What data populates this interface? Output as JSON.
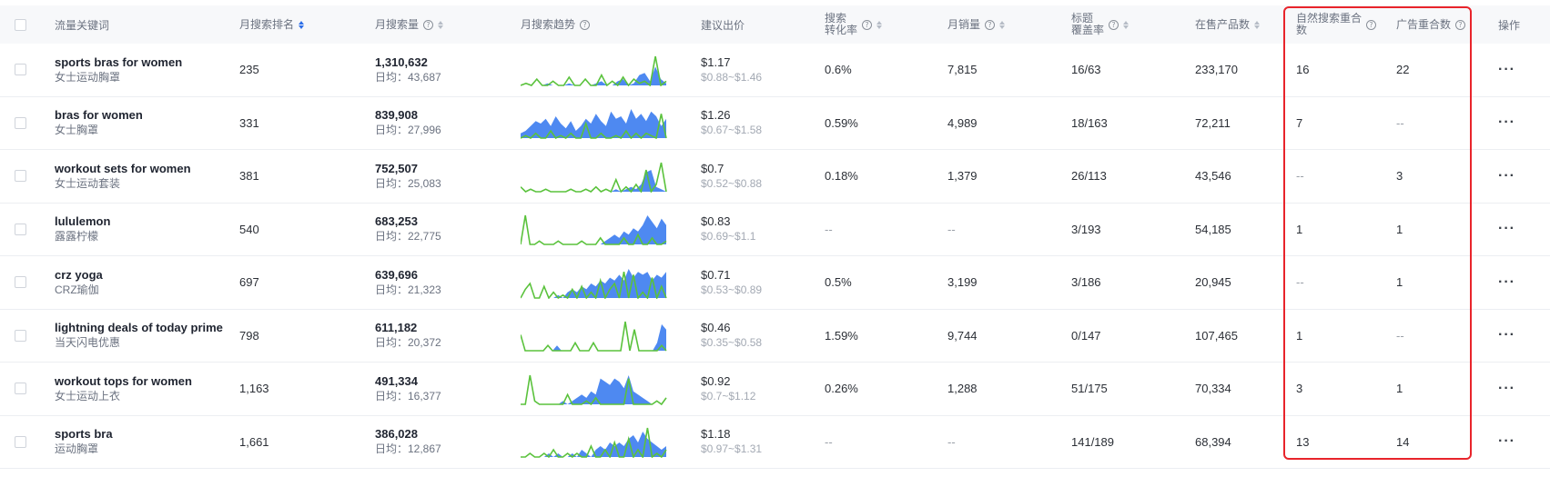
{
  "headers": {
    "keyword": "流量关键词",
    "rank": "月搜索排名",
    "volume": "月搜索量",
    "trend": "月搜索趋势",
    "bid": "建议出价",
    "conv_line1": "搜索",
    "conv_line2": "转化率",
    "sales": "月销量",
    "title_line1": "标题",
    "title_line2": "覆盖率",
    "products": "在售产品数",
    "organic_line1": "自然搜索重合",
    "organic_line2": "数",
    "ads": "广告重合数",
    "actions": "操作"
  },
  "icons": {
    "help": "question-circle-icon",
    "sort": "sort-caret-icon",
    "more": "more-horizontal-icon",
    "checkbox": "checkbox"
  },
  "colors": {
    "highlight_border": "#e8242b",
    "trend_blue": "#3b7cf0",
    "trend_green": "#5ac23c",
    "sort_active": "#2b6de8"
  },
  "rows": [
    {
      "keyword": "sports bras for women",
      "keyword_cn": "女士运动胸罩",
      "rank": "235",
      "volume": "1,310,632",
      "daily": "日均：43,687",
      "bid": "$1.17",
      "bid_range": "$0.88~$1.46",
      "conv": "0.6%",
      "sales": "7,815",
      "title_cov": "16/63",
      "products": "233,170",
      "organic": "16",
      "ads": "22",
      "trend_blue": [
        0,
        0,
        0,
        0,
        0,
        1,
        0,
        0,
        0,
        1,
        0,
        0,
        0,
        0,
        1,
        2,
        0,
        0,
        2,
        3,
        0,
        1,
        5,
        6,
        2,
        9,
        3,
        1
      ],
      "trend_green": [
        0,
        1,
        0,
        3,
        0,
        0,
        2,
        0,
        0,
        4,
        0,
        0,
        3,
        0,
        0,
        5,
        0,
        2,
        0,
        4,
        0,
        3,
        1,
        2,
        0,
        14,
        0,
        2
      ]
    },
    {
      "keyword": "bras for women",
      "keyword_cn": "女士胸罩",
      "rank": "331",
      "volume": "839,908",
      "daily": "日均：27,996",
      "bid": "$1.26",
      "bid_range": "$0.67~$1.58",
      "conv": "0.59%",
      "sales": "4,989",
      "title_cov": "18/163",
      "products": "72,211",
      "organic": "7",
      "ads": "--",
      "trend_blue": [
        2,
        3,
        5,
        7,
        6,
        8,
        5,
        9,
        6,
        4,
        7,
        3,
        5,
        8,
        6,
        10,
        7,
        5,
        11,
        8,
        9,
        6,
        12,
        8,
        10,
        7,
        11,
        9,
        5,
        8
      ],
      "trend_green": [
        0,
        1,
        0,
        2,
        0,
        0,
        3,
        0,
        1,
        0,
        2,
        0,
        0,
        6,
        0,
        0,
        2,
        0,
        0,
        1,
        0,
        3,
        0,
        2,
        0,
        2,
        1,
        0,
        10,
        0
      ]
    },
    {
      "keyword": "workout sets for women",
      "keyword_cn": "女士运动套装",
      "rank": "381",
      "volume": "752,507",
      "daily": "日均：25,083",
      "bid": "$0.7",
      "bid_range": "$0.52~$0.88",
      "conv": "0.18%",
      "sales": "1,379",
      "title_cov": "26/113",
      "products": "43,546",
      "organic": "--",
      "ads": "3",
      "trend_blue": [
        0,
        0,
        0,
        0,
        0,
        0,
        0,
        0,
        0,
        0,
        0,
        0,
        0,
        0,
        0,
        0,
        0,
        0,
        0,
        1,
        0,
        1,
        2,
        1,
        3,
        8,
        9,
        2,
        1,
        0
      ],
      "trend_green": [
        2,
        0,
        1,
        0,
        0,
        1,
        0,
        0,
        0,
        0,
        1,
        0,
        0,
        1,
        0,
        2,
        0,
        1,
        0,
        5,
        0,
        2,
        0,
        3,
        0,
        9,
        0,
        3,
        12,
        0
      ]
    },
    {
      "keyword": "lululemon",
      "keyword_cn": "露露柠檬",
      "rank": "540",
      "volume": "683,253",
      "daily": "日均：22,775",
      "bid": "$0.83",
      "bid_range": "$0.69~$1.1",
      "conv": "--",
      "sales": "--",
      "title_cov": "3/193",
      "products": "54,185",
      "organic": "1",
      "ads": "1",
      "trend_blue": [
        0,
        0,
        0,
        0,
        0,
        0,
        0,
        0,
        0,
        0,
        0,
        0,
        0,
        0,
        0,
        0,
        0,
        0,
        1,
        2,
        3,
        2,
        4,
        3,
        5,
        4,
        6,
        9,
        7,
        5,
        8,
        6
      ],
      "trend_green": [
        0,
        9,
        0,
        0,
        1,
        0,
        0,
        0,
        1,
        0,
        0,
        0,
        0,
        1,
        0,
        0,
        0,
        2,
        0,
        0,
        0,
        0,
        2,
        0,
        0,
        3,
        0,
        0,
        2,
        0,
        0,
        1
      ]
    },
    {
      "keyword": "crz yoga",
      "keyword_cn": "CRZ瑜伽",
      "rank": "697",
      "volume": "639,696",
      "daily": "日均：21,323",
      "bid": "$0.71",
      "bid_range": "$0.53~$0.89",
      "conv": "0.5%",
      "sales": "3,199",
      "title_cov": "3/186",
      "products": "20,945",
      "organic": "--",
      "ads": "1",
      "trend_blue": [
        0,
        0,
        0,
        0,
        0,
        0,
        0,
        0,
        1,
        0,
        2,
        3,
        2,
        4,
        3,
        5,
        4,
        6,
        5,
        7,
        6,
        8,
        6,
        10,
        7,
        9,
        8,
        9,
        6,
        8,
        7,
        9
      ],
      "trend_green": [
        0,
        3,
        5,
        0,
        0,
        4,
        0,
        2,
        0,
        1,
        0,
        3,
        0,
        4,
        0,
        2,
        0,
        6,
        0,
        3,
        5,
        0,
        9,
        0,
        8,
        0,
        2,
        0,
        7,
        0,
        4,
        0
      ]
    },
    {
      "keyword": "lightning deals of today prime",
      "keyword_cn": "当天闪电优惠",
      "rank": "798",
      "volume": "611,182",
      "daily": "日均：20,372",
      "bid": "$0.46",
      "bid_range": "$0.35~$0.58",
      "conv": "1.59%",
      "sales": "9,744",
      "title_cov": "0/147",
      "products": "107,465",
      "organic": "1",
      "ads": "--",
      "trend_blue": [
        0,
        0,
        0,
        0,
        0,
        0,
        0,
        0,
        2,
        0,
        0,
        0,
        0,
        0,
        0,
        0,
        0,
        0,
        0,
        0,
        0,
        0,
        0,
        0,
        0,
        0,
        0,
        0,
        0,
        0,
        3,
        10,
        8
      ],
      "trend_green": [
        6,
        0,
        0,
        0,
        0,
        0,
        2,
        0,
        0,
        0,
        0,
        0,
        3,
        0,
        0,
        0,
        3,
        0,
        0,
        0,
        0,
        0,
        0,
        11,
        0,
        8,
        0,
        0,
        0,
        0,
        0,
        2,
        0
      ]
    },
    {
      "keyword": "workout tops for women",
      "keyword_cn": "女士运动上衣",
      "rank": "1,163",
      "volume": "491,334",
      "daily": "日均：16,377",
      "bid": "$0.92",
      "bid_range": "$0.7~$1.12",
      "conv": "0.26%",
      "sales": "1,288",
      "title_cov": "51/175",
      "products": "70,334",
      "organic": "3",
      "ads": "1",
      "trend_blue": [
        0,
        0,
        0,
        0,
        0,
        0,
        0,
        0,
        0,
        1,
        0,
        1,
        2,
        3,
        2,
        4,
        3,
        8,
        7,
        6,
        8,
        7,
        5,
        9,
        4,
        3,
        2,
        1,
        0,
        0,
        0,
        0
      ],
      "trend_green": [
        0,
        0,
        9,
        1,
        0,
        0,
        0,
        0,
        0,
        0,
        3,
        0,
        0,
        0,
        1,
        0,
        2,
        0,
        0,
        0,
        0,
        0,
        0,
        8,
        0,
        0,
        0,
        0,
        0,
        1,
        0,
        2
      ]
    },
    {
      "keyword": "sports bra",
      "keyword_cn": "运动胸罩",
      "rank": "1,661",
      "volume": "386,028",
      "daily": "日均：12,867",
      "bid": "$1.18",
      "bid_range": "$0.97~$1.31",
      "conv": "--",
      "sales": "--",
      "title_cov": "141/189",
      "products": "68,394",
      "organic": "13",
      "ads": "14",
      "trend_blue": [
        0,
        0,
        0,
        0,
        0,
        0,
        1,
        0,
        1,
        0,
        0,
        1,
        0,
        2,
        1,
        0,
        2,
        3,
        2,
        4,
        3,
        4,
        3,
        5,
        6,
        4,
        7,
        5,
        4,
        3,
        2,
        3
      ],
      "trend_green": [
        0,
        0,
        1,
        0,
        0,
        1,
        0,
        2,
        0,
        0,
        1,
        0,
        1,
        0,
        0,
        3,
        0,
        0,
        2,
        0,
        4,
        0,
        0,
        5,
        0,
        2,
        0,
        8,
        0,
        1,
        0,
        2
      ]
    }
  ]
}
